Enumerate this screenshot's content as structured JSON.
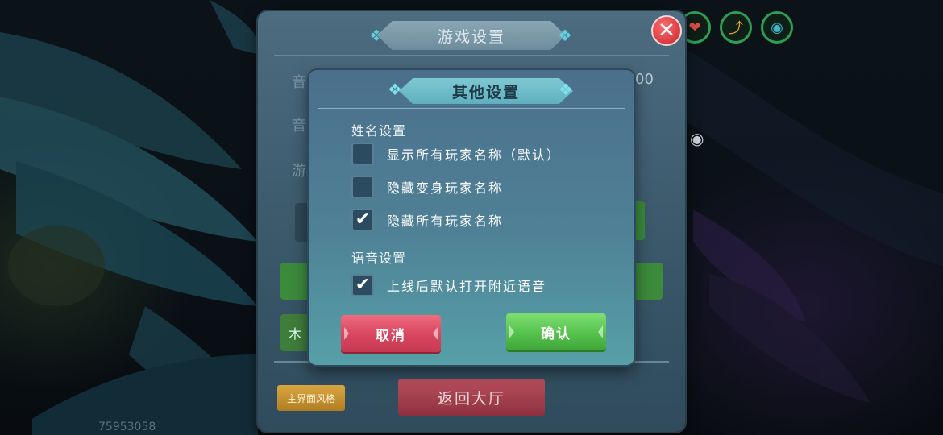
{
  "outer_dialog": {
    "title": "游戏设置",
    "ghost_labels": [
      "音",
      "音",
      "游"
    ],
    "ghost_value": "00",
    "ghost_button_text": "木",
    "bottom_left_button": "主界面风格",
    "back_button": "返回大厅",
    "close_icon": "close-icon"
  },
  "hud": {
    "icons": [
      "heart-icon",
      "shoe-icon",
      "water-drop-icon",
      "eye-icon"
    ]
  },
  "footer": {
    "player_id": "75953058"
  },
  "inner_dialog": {
    "title": "其他设置",
    "name_section": {
      "label": "姓名设置",
      "options": [
        {
          "label": "显示所有玩家名称（默认）",
          "checked": false
        },
        {
          "label": "隐藏变身玩家名称",
          "checked": false
        },
        {
          "label": "隐藏所有玩家名称",
          "checked": true
        }
      ]
    },
    "voice_section": {
      "label": "语音设置",
      "options": [
        {
          "label": "上线后默认打开附近语音",
          "checked": true
        }
      ]
    },
    "cancel_label": "取消",
    "confirm_label": "确认",
    "check_glyph": "✔"
  },
  "colors": {
    "cancel": "#d7455e",
    "confirm": "#55c24c",
    "accent_border": "#2f9e55"
  }
}
